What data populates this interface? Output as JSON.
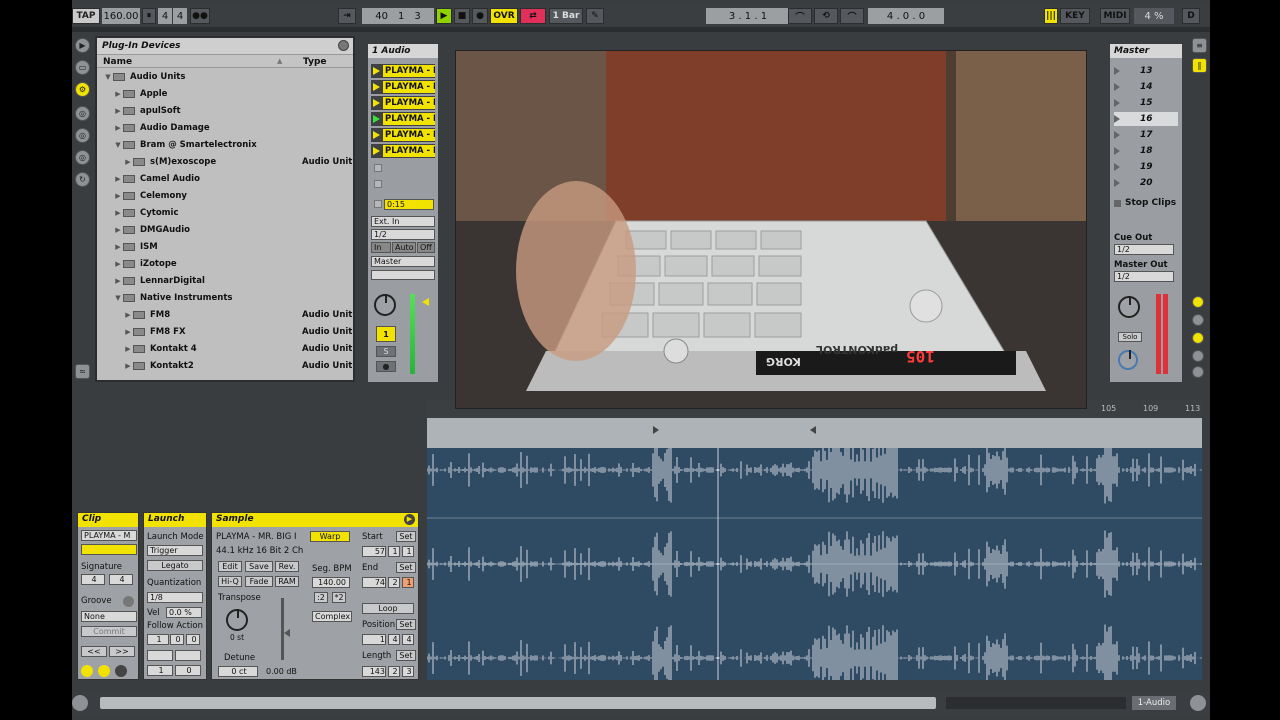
{
  "transport": {
    "tap": "TAP",
    "tempo": "160.00",
    "signature_num": "4",
    "signature_den": "4",
    "position_bar": "40",
    "position_beat": "1",
    "position_sixteenth": "3",
    "ovr": "OVR",
    "quantize": "1 Bar",
    "loop_start": "3 . 1 . 1",
    "loop_length": "4 . 0 . 0",
    "key": "KEY",
    "midi": "MIDI",
    "cpu": "4 %",
    "d_label": "D"
  },
  "browser": {
    "title": "Plug-In Devices",
    "col_name": "Name",
    "col_type": "Type",
    "root": "Audio Units",
    "items": [
      {
        "label": "Apple",
        "type": "",
        "level": 1,
        "open": false
      },
      {
        "label": "apulSoft",
        "type": "",
        "level": 1,
        "open": false
      },
      {
        "label": "Audio Damage",
        "type": "",
        "level": 1,
        "open": false
      },
      {
        "label": "Bram @ Smartelectronix",
        "type": "",
        "level": 1,
        "open": true
      },
      {
        "label": "s(M)exoscope",
        "type": "Audio Unit",
        "level": 2,
        "open": false
      },
      {
        "label": "Camel Audio",
        "type": "",
        "level": 1,
        "open": false
      },
      {
        "label": "Celemony",
        "type": "",
        "level": 1,
        "open": false
      },
      {
        "label": "Cytomic",
        "type": "",
        "level": 1,
        "open": false
      },
      {
        "label": "DMGAudio",
        "type": "",
        "level": 1,
        "open": false
      },
      {
        "label": "ISM",
        "type": "",
        "level": 1,
        "open": false
      },
      {
        "label": "iZotope",
        "type": "",
        "level": 1,
        "open": false
      },
      {
        "label": "LennarDigital",
        "type": "",
        "level": 1,
        "open": false
      },
      {
        "label": "Native Instruments",
        "type": "",
        "level": 1,
        "open": true
      },
      {
        "label": "FM8",
        "type": "Audio Unit",
        "level": 2,
        "open": false
      },
      {
        "label": "FM8 FX",
        "type": "Audio Unit",
        "level": 2,
        "open": false
      },
      {
        "label": "Kontakt 4",
        "type": "Audio Unit",
        "level": 2,
        "open": false
      },
      {
        "label": "Kontakt2",
        "type": "Audio Unit",
        "level": 2,
        "open": false
      }
    ]
  },
  "session": {
    "track_title": "1 Audio",
    "clips": [
      "PLAYMA - M",
      "PLAYMA - M",
      "PLAYMA - M",
      "PLAYMA - M",
      "PLAYMA - M",
      "PLAYMA - M"
    ],
    "time": "0:15",
    "input_type": "Ext. In",
    "input_channel": "1/2",
    "monitor_in": "In",
    "monitor_auto": "Auto",
    "monitor_off": "Off",
    "output": "Master",
    "track_number": "1",
    "solo": "S"
  },
  "master": {
    "title": "Master",
    "scenes": [
      "13",
      "14",
      "15",
      "16",
      "17",
      "18",
      "19",
      "20"
    ],
    "stop_clips": "Stop Clips",
    "cue_out": "Cue Out",
    "cue_value": "1/2",
    "master_out": "Master Out",
    "master_value": "1/2",
    "solo": "Solo"
  },
  "video": {
    "device_brand": "KORG",
    "device_name": "padKONTROL",
    "display": "105"
  },
  "arrangement": {
    "ruler_ticks": [
      "105",
      "109",
      "113"
    ]
  },
  "clip_panel": {
    "title": "Clip",
    "name": "PLAYMA - M",
    "signature_label": "Signature",
    "sig_num": "4",
    "sig_den": "4",
    "groove_label": "Groove",
    "groove_value": "None",
    "commit": "Commit"
  },
  "launch_panel": {
    "title": "Launch",
    "mode_label": "Launch Mode",
    "mode_value": "Trigger",
    "legato": "Legato",
    "quant_label": "Quantization",
    "quant_value": "1/8",
    "vel_label": "Vel",
    "vel_value": "0.0 %",
    "follow_label": "Follow Action",
    "f1": "1",
    "f2": "0",
    "f3": "0",
    "f4": "1",
    "f5": "0"
  },
  "sample_panel": {
    "title": "Sample",
    "name": "PLAYMA - MR. BIG I",
    "info": "44.1 kHz 16 Bit 2 Ch",
    "edit": "Edit",
    "save": "Save",
    "rev": "Rev.",
    "hiq": "Hi-Q",
    "fade": "Fade",
    "ram": "RAM",
    "transpose_label": "Transpose",
    "transpose_value": "0 st",
    "detune_label": "Detune",
    "detune_value": "0 ct",
    "gain_value": "0.00 dB",
    "warp": "Warp",
    "seg_bpm_label": "Seg. BPM",
    "seg_bpm_value": "140.00",
    "half": ":2",
    "double": "*2",
    "warp_mode": "Complex",
    "start_label": "Start",
    "start_values": [
      "57",
      "1",
      "1"
    ],
    "end_label": "End",
    "end_values": [
      "74",
      "2",
      "1"
    ],
    "loop": "Loop",
    "position_label": "Position",
    "position_values": [
      "1",
      "4",
      "4"
    ],
    "length_label": "Length",
    "length_values": [
      "143",
      "2",
      "3"
    ],
    "set": "Set"
  },
  "status": {
    "track_name": "1-Audio"
  }
}
